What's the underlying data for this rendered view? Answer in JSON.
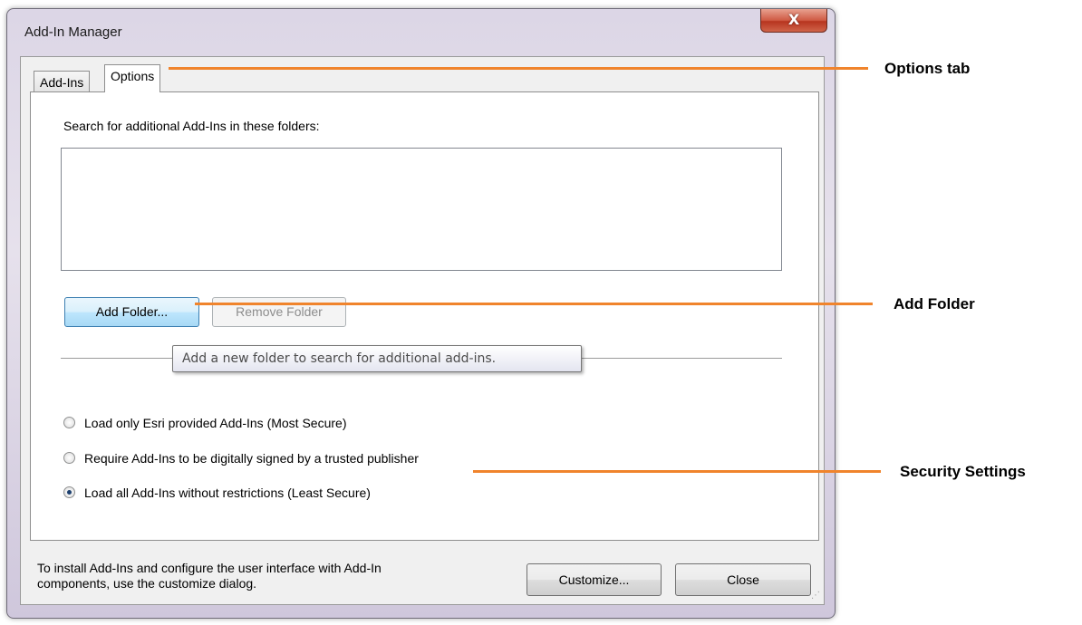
{
  "window": {
    "title": "Add-In Manager",
    "close_glyph": "X"
  },
  "tabs": [
    {
      "label": "Add-Ins"
    },
    {
      "label": "Options"
    }
  ],
  "options": {
    "search_label": "Search for additional Add-Ins in these folders:",
    "add_folder_label": "Add Folder...",
    "remove_folder_label": "Remove Folder",
    "tooltip": "Add a new folder to search for additional add-ins.",
    "security_options": [
      {
        "label": "Load only Esri provided Add-Ins (Most Secure)",
        "checked": false
      },
      {
        "label": "Require Add-Ins to be digitally signed by a trusted publisher",
        "checked": false
      },
      {
        "label": "Load all Add-Ins without restrictions (Least Secure)",
        "checked": true
      }
    ]
  },
  "footer": {
    "text_line1": "To install Add-Ins and configure the user interface with Add-In",
    "text_line2": "components, use the customize dialog.",
    "customize_label": "Customize...",
    "close_label": "Close"
  },
  "callouts": {
    "options_tab": "Options tab",
    "add_folder": "Add Folder",
    "security_settings": "Security Settings",
    "line_color": "#f0842c"
  }
}
